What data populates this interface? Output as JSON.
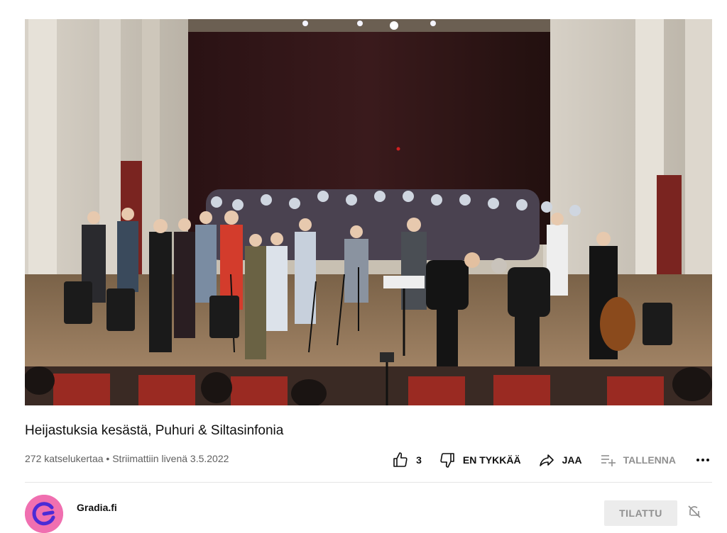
{
  "video": {
    "title": "Heijastuksia kesästä, Puhuri & Siltasinfonia",
    "views": "272 katselukertaa",
    "separator": "•",
    "streamed": "Striimattiin livenä 3.5.2022"
  },
  "actions": {
    "like_count": "3",
    "dislike_label": "EN TYKKÄÄ",
    "share_label": "JAA",
    "save_label": "TALLENNA"
  },
  "channel": {
    "name": "Gradia.fi",
    "subscribe_label": "TILATTU"
  },
  "icons": {
    "like": "thumbs-up-icon",
    "dislike": "thumbs-down-icon",
    "share": "share-arrow-icon",
    "save": "playlist-add-icon",
    "more": "more-horizontal-icon",
    "notifications": "bell-off-icon"
  },
  "colors": {
    "avatar": "#f06fb0",
    "text": "#0f0f0f",
    "muted": "#606060"
  }
}
